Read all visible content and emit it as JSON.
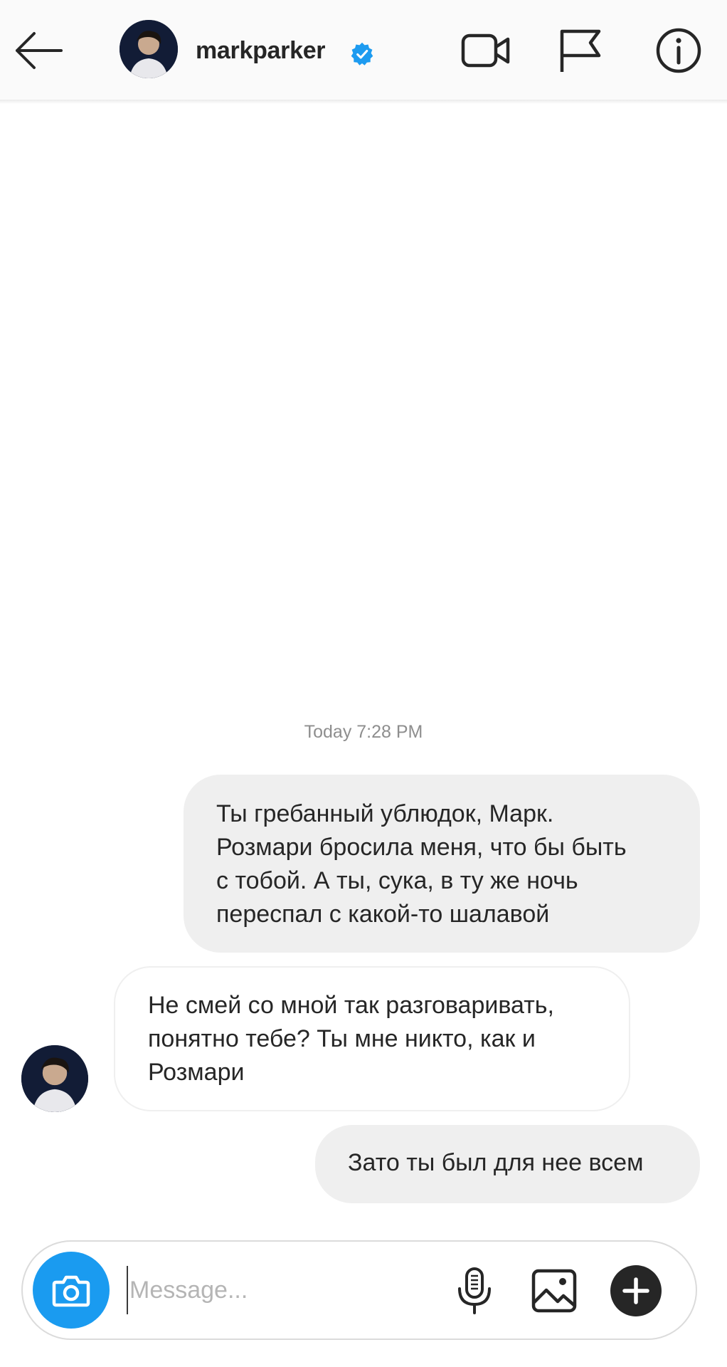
{
  "header": {
    "username": "markparker",
    "verified": true,
    "back_icon": "arrow-left-icon",
    "video_icon": "video-camera-icon",
    "flag_icon": "flag-icon",
    "info_icon": "info-icon"
  },
  "chat": {
    "timestamp": "Today 7:28 PM",
    "messages": [
      {
        "direction": "outgoing",
        "lines": [
          "Ты гребанный ублюдок, Марк.",
          "Розмари бросила меня, что бы быть",
          "с тобой. А ты, сука, в ту же ночь",
          "переспал с какой-то шалавой"
        ]
      },
      {
        "direction": "incoming",
        "lines": [
          "Не смей со мной так разговаривать,",
          "понятно тебе? Ты мне никто, как и",
          "Розмари"
        ]
      },
      {
        "direction": "outgoing",
        "lines": [
          "Зато ты был для нее всем"
        ]
      }
    ]
  },
  "composer": {
    "placeholder": "Message...",
    "value": "",
    "camera_icon": "camera-icon",
    "mic_icon": "microphone-icon",
    "gallery_icon": "image-gallery-icon",
    "plus_icon": "plus-icon"
  },
  "colors": {
    "accent": "#1a9bf0",
    "outgoing_bubble": "#efefef",
    "incoming_border": "#efefef",
    "verified_badge": "#1d9bf0",
    "text": "#262626",
    "timestamp": "#8e8e8e"
  }
}
